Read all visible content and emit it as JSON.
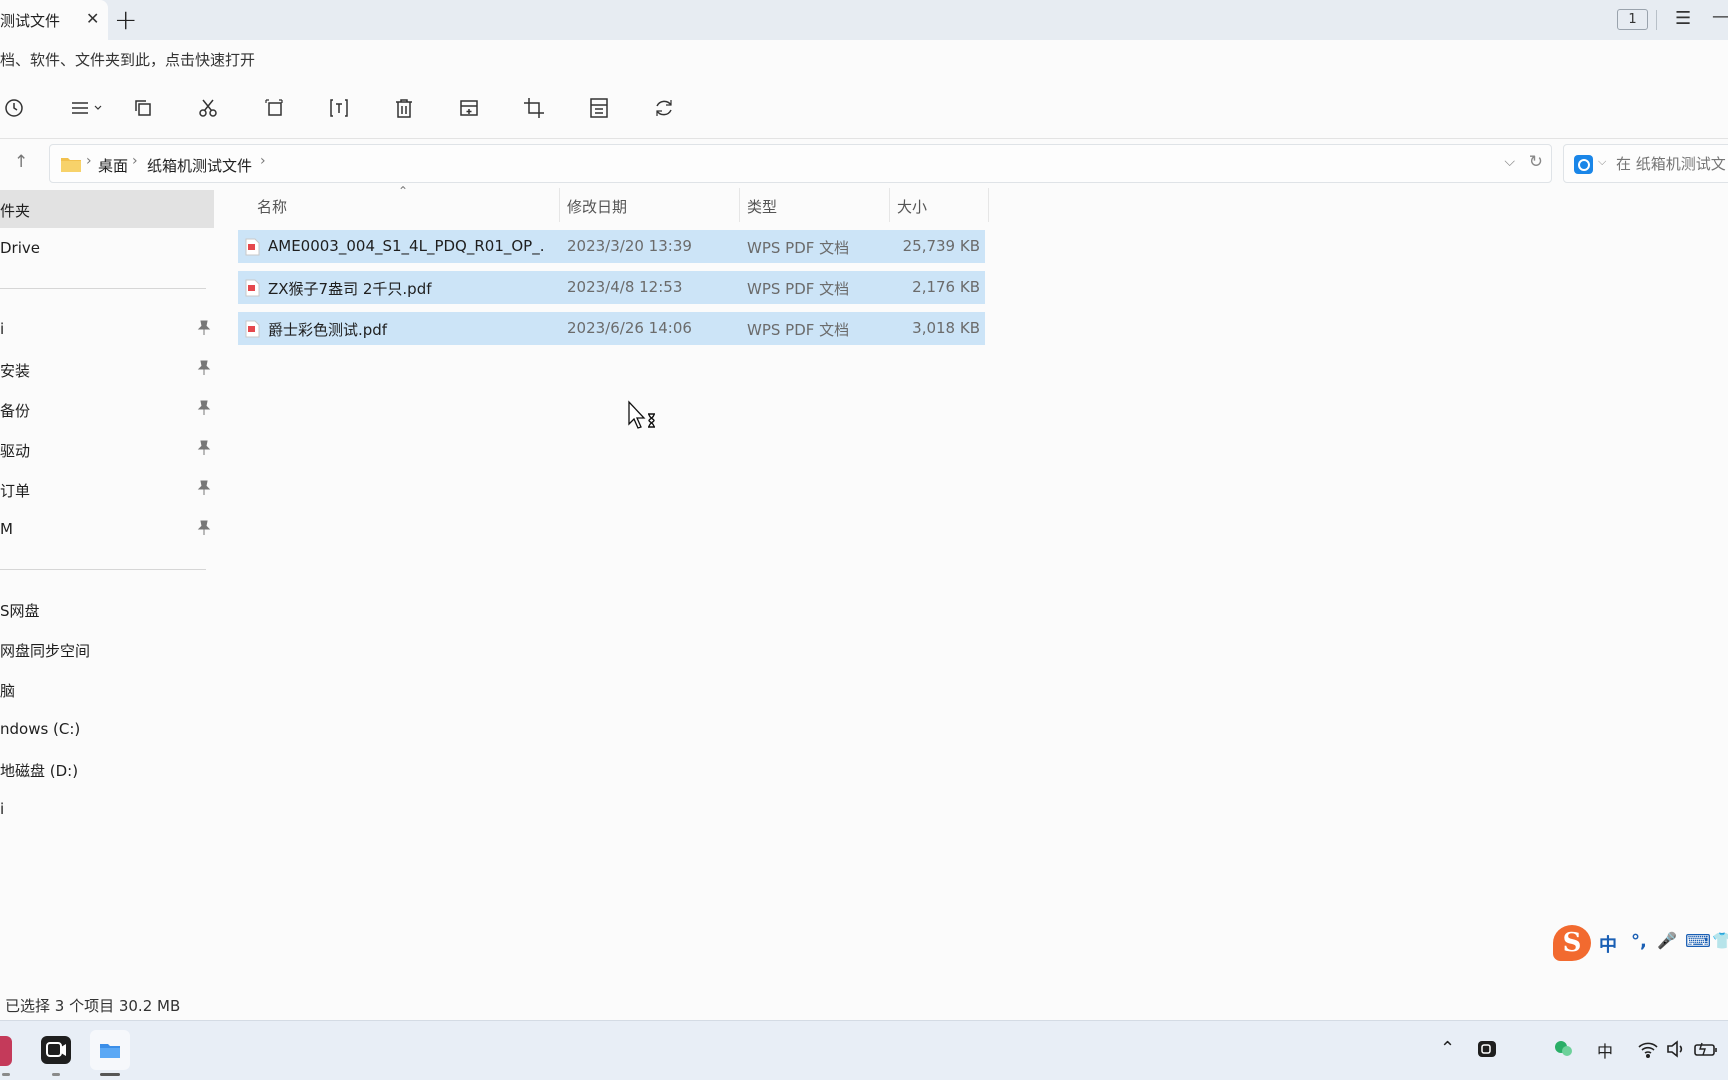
{
  "window": {
    "tab_title": "测试文件",
    "tab_close": "✕",
    "tab_add": "+",
    "badge": "1",
    "menu_icon": "☰",
    "min_icon": "—"
  },
  "quickbar": {
    "hint": "档、软件、文件夹到此，点击快速打开"
  },
  "toolbar": {
    "icons": [
      "clock-icon",
      "view-list-icon",
      "copy-icon",
      "cut-icon",
      "copy-path-icon",
      "rename-icon",
      "delete-icon",
      "new-item-icon",
      "crop-icon",
      "calculator-icon",
      "rotate-icon"
    ]
  },
  "address": {
    "crumbs": [
      "桌面",
      "纸箱机测试文件"
    ],
    "separator": "›"
  },
  "search": {
    "placeholder": "在 纸箱机测试文"
  },
  "sidebar": {
    "top": [
      {
        "label": "件夹",
        "active": true
      },
      {
        "label": "Drive",
        "active": false
      }
    ],
    "pinned": [
      "i",
      "安装",
      "备份",
      "驱动",
      "订单",
      "M"
    ],
    "drives": [
      "S网盘",
      "网盘同步空间",
      "脑",
      "ndows (C:)",
      "地磁盘 (D:)",
      "i"
    ]
  },
  "columns": {
    "name": "名称",
    "date": "修改日期",
    "type": "类型",
    "size": "大小"
  },
  "files": [
    {
      "name": "AME0003_004_S1_4L_PDQ_R01_OP_...",
      "date": "2023/3/20 13:39",
      "type": "WPS PDF 文档",
      "size": "25,739 KB"
    },
    {
      "name": "ZX猴子7盎司 2千只.pdf",
      "date": "2023/4/8 12:53",
      "type": "WPS PDF 文档",
      "size": "2,176 KB"
    },
    {
      "name": "爵士彩色测试.pdf",
      "date": "2023/6/26 14:06",
      "type": "WPS PDF 文档",
      "size": "3,018 KB"
    }
  ],
  "status": {
    "text": "已选择 3 个项目  30.2 MB"
  },
  "ime": {
    "items": [
      "中",
      "°,",
      "🎤",
      "⌨",
      "👕"
    ]
  },
  "colors": {
    "selection": "#cce4f7",
    "accent": "#1a86e8",
    "ime_logo": "#f26a2f"
  }
}
